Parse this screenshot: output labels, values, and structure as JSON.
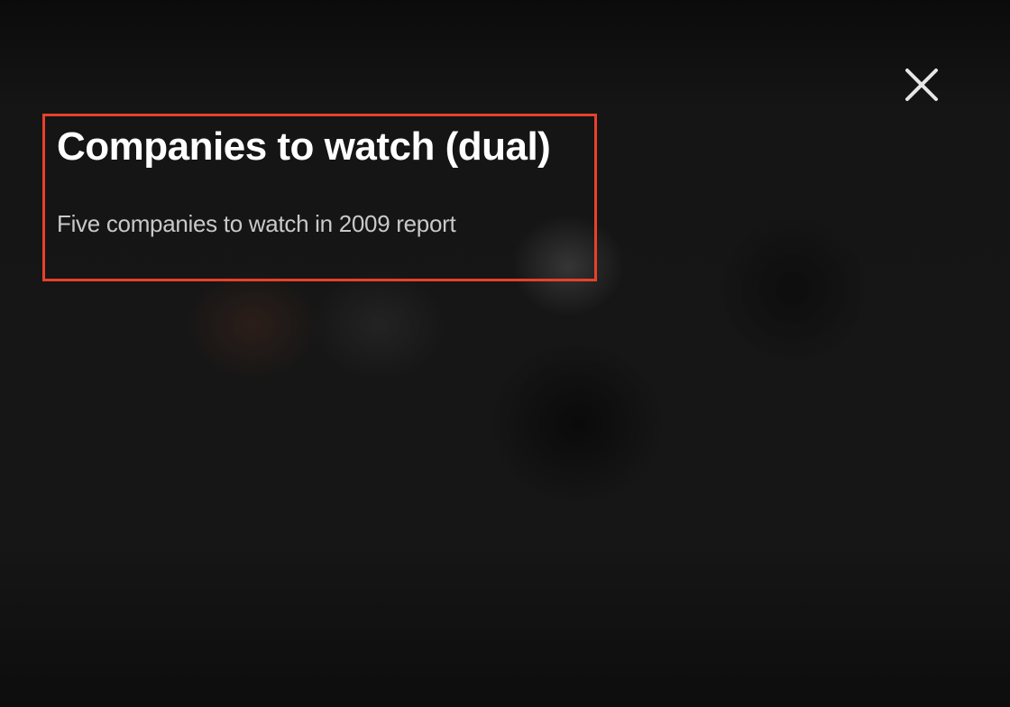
{
  "modal": {
    "title": "Companies to watch (dual)",
    "subtitle": "Five companies to watch in 2009 report",
    "close_icon": "close-icon"
  },
  "colors": {
    "highlight_border": "#e8412a",
    "title_text": "#ffffff",
    "subtitle_text": "#c9c9c9",
    "icon": "#e6e6e6"
  }
}
